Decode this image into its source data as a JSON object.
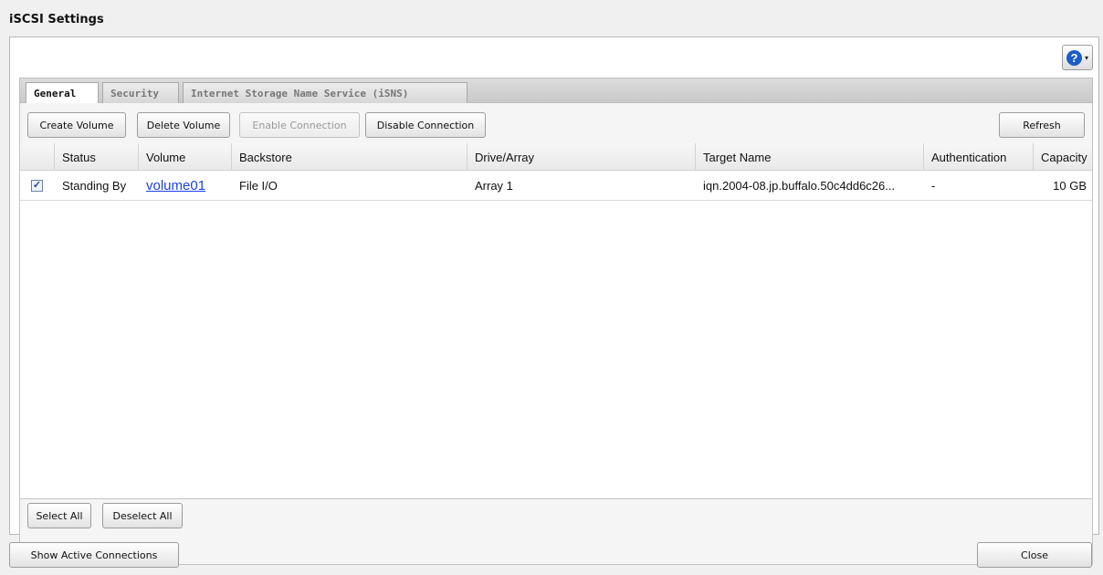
{
  "window": {
    "title": "iSCSI Settings"
  },
  "help": {
    "glyph": "?",
    "caret": "▾",
    "icon": "help-icon"
  },
  "tabs": [
    {
      "label": "General",
      "active": true
    },
    {
      "label": "Security",
      "active": false
    },
    {
      "label": "Internet Storage Name Service (iSNS)",
      "active": false
    }
  ],
  "toolbar": {
    "create_volume": "Create Volume",
    "delete_volume": "Delete Volume",
    "enable_connection": "Enable Connection",
    "disable_connection": "Disable Connection",
    "refresh": "Refresh"
  },
  "table": {
    "columns": [
      "",
      "Status",
      "Volume",
      "Backstore",
      "Drive/Array",
      "Target Name",
      "Authentication",
      "Capacity"
    ],
    "rows": [
      {
        "checked": true,
        "status": "Standing By",
        "volume": "volume01",
        "backstore": "File I/O",
        "drive_array": "Array 1",
        "target_name": "iqn.2004-08.jp.buffalo.50c4dd6c26...",
        "authentication": "-",
        "capacity": "10 GB"
      }
    ]
  },
  "selection": {
    "select_all": "Select All",
    "deselect_all": "Deselect All"
  },
  "bottom": {
    "show_active_connections": "Show Active Connections",
    "close": "Close"
  },
  "colors": {
    "link": "#1a3ff0",
    "help_blue": "#1b5cc8"
  }
}
